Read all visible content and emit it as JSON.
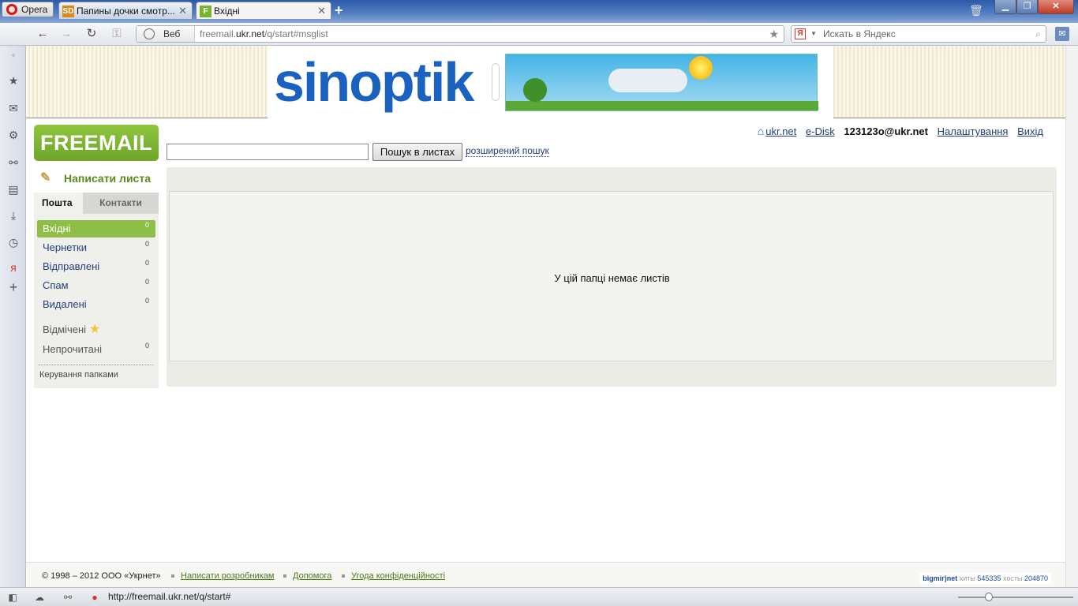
{
  "browser": {
    "opera_label": "Opera",
    "tabs": [
      {
        "icon": "SD",
        "label": "Папины дочки смотр..."
      },
      {
        "icon": "F",
        "label": "Вхідні"
      }
    ],
    "new_tab": "+",
    "address_scheme": "Веб",
    "url_pre": "freemail.",
    "url_host": "ukr.net",
    "url_path": "/q/start#msglist",
    "search_placeholder": "Искать в Яндекс",
    "search_engine_icon": "Я",
    "status_url": "http://freemail.ukr.net/q/start#"
  },
  "banner": {
    "logo_text": "sinoptik"
  },
  "mail": {
    "logo": "FREEMAIL",
    "compose": "Написати листа",
    "tabs": {
      "mail": "Пошта",
      "contacts": "Контакти"
    },
    "folders": [
      {
        "label": "Вхідні",
        "count": "0"
      },
      {
        "label": "Чернетки",
        "count": "0"
      },
      {
        "label": "Відправлені",
        "count": "0"
      },
      {
        "label": "Спам",
        "count": "0"
      },
      {
        "label": "Видалені",
        "count": "0"
      }
    ],
    "starred": "Відмічені",
    "unread": {
      "label": "Непрочитані",
      "count": "0"
    },
    "manage_folders": "Керування папками",
    "top_links": {
      "home": "ukr.net",
      "disk": "e-Disk",
      "user": "123123o@ukr.net",
      "settings": "Налаштування",
      "logout": "Вихід"
    },
    "search": {
      "value": "",
      "button": "Пошук в листах",
      "advanced": "розширений пошук"
    },
    "empty_message": "У цій папці немає листів"
  },
  "footer": {
    "copyright": "© 1998 – 2012 ООО «Укрнет»",
    "links": [
      "Написати розробникам",
      "Допомога",
      "Угода конфіденційності"
    ],
    "counter": {
      "brand": "bigmir)net",
      "hits_label": "хиты",
      "hits": "545335",
      "hosts_label": "хосты",
      "hosts": "204870"
    }
  }
}
